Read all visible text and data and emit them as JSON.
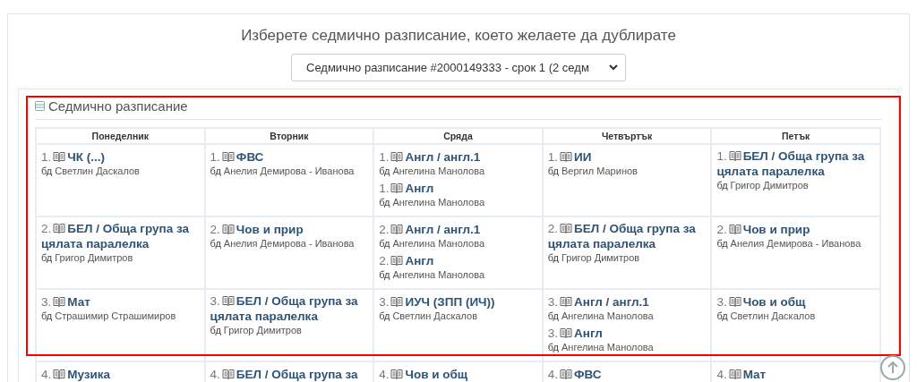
{
  "page": {
    "title": "Изберете седмично разписание, което желаете да дублирате",
    "schedule_select": {
      "value": "Седмично разписание #2000149333 - срок 1 (2 седм"
    }
  },
  "panel": {
    "title": "Седмично разписание"
  },
  "table": {
    "columns": [
      "Понеделник",
      "Вторник",
      "Сряда",
      "Четвъртък",
      "Петък"
    ],
    "rows": [
      {
        "cells": [
          [
            {
              "number": "1.",
              "subject": "ЧК (...)",
              "marker": "бд",
              "teacher": "Светлин Даскалов"
            }
          ],
          [
            {
              "number": "1.",
              "subject": "ФВС",
              "marker": "бд",
              "teacher": "Анелия Демирова - Иванова"
            }
          ],
          [
            {
              "number": "1.",
              "subject": "Англ / англ.1",
              "marker": "бд",
              "teacher": "Ангелина Манолова"
            },
            {
              "number": "1.",
              "subject": "Англ",
              "marker": "бд",
              "teacher": "Ангелина Манолова"
            }
          ],
          [
            {
              "number": "1.",
              "subject": "ИИ",
              "marker": "бд",
              "teacher": "Вергил Маринов"
            }
          ],
          [
            {
              "number": "1.",
              "subject": "БЕЛ / Обща група за цялата паралелка",
              "marker": "бд",
              "teacher": "Григор Димитров"
            }
          ]
        ]
      },
      {
        "cells": [
          [
            {
              "number": "2.",
              "subject": "БЕЛ / Обща група за цялата паралелка",
              "marker": "бд",
              "teacher": "Григор Димитров"
            }
          ],
          [
            {
              "number": "2.",
              "subject": "Чов и прир",
              "marker": "бд",
              "teacher": "Анелия Демирова - Иванова"
            }
          ],
          [
            {
              "number": "2.",
              "subject": "Англ / англ.1",
              "marker": "бд",
              "teacher": "Ангелина Манолова"
            },
            {
              "number": "2.",
              "subject": "Англ",
              "marker": "бд",
              "teacher": "Ангелина Манолова"
            }
          ],
          [
            {
              "number": "2.",
              "subject": "БЕЛ / Обща група за цялата паралелка",
              "marker": "бд",
              "teacher": "Григор Димитров"
            }
          ],
          [
            {
              "number": "2.",
              "subject": "Чов и прир",
              "marker": "бд",
              "teacher": "Анелия Демирова - Иванова"
            }
          ]
        ]
      },
      {
        "cells": [
          [
            {
              "number": "3.",
              "subject": "Мат",
              "marker": "бд",
              "teacher": "Страшимир Страшимиров"
            }
          ],
          [
            {
              "number": "3.",
              "subject": "БЕЛ / Обща група за цялата паралелка",
              "marker": "бд",
              "teacher": "Григор Димитров"
            }
          ],
          [
            {
              "number": "3.",
              "subject": "ИУЧ (ЗПП (ИЧ))",
              "marker": "бд",
              "teacher": "Светлин Даскалов"
            }
          ],
          [
            {
              "number": "3.",
              "subject": "Англ / англ.1",
              "marker": "бд",
              "teacher": "Ангелина Манолова"
            },
            {
              "number": "3.",
              "subject": "Англ",
              "marker": "бд",
              "teacher": "Ангелина Манолова"
            }
          ],
          [
            {
              "number": "3.",
              "subject": "Чов и общ",
              "marker": "бд",
              "teacher": "Светлин Даскалов"
            }
          ]
        ]
      },
      {
        "cells": [
          [
            {
              "number": "4.",
              "subject": "Музика"
            }
          ],
          [
            {
              "number": "4.",
              "subject": "БЕЛ / Обща група за"
            }
          ],
          [
            {
              "number": "4.",
              "subject": "Чов и общ"
            }
          ],
          [
            {
              "number": "4.",
              "subject": "ФВС"
            }
          ],
          [
            {
              "number": "4.",
              "subject": "Мат"
            }
          ]
        ]
      }
    ]
  }
}
